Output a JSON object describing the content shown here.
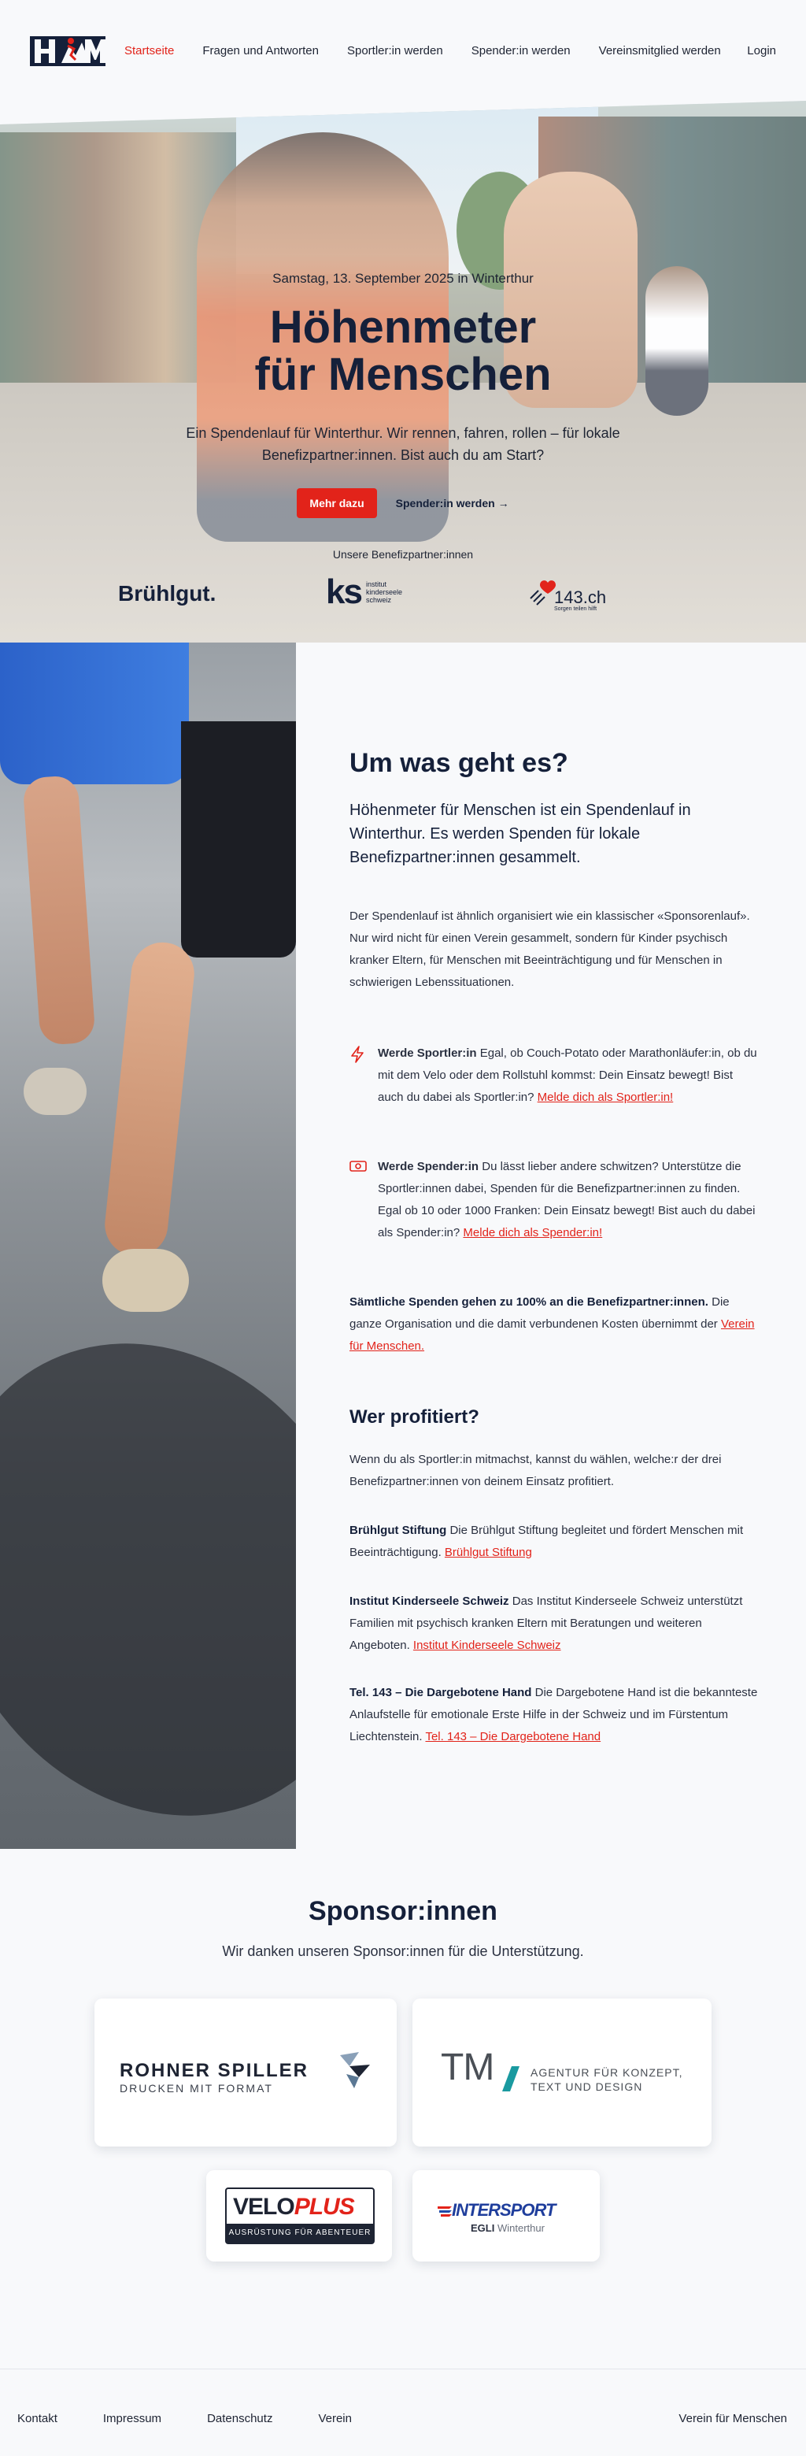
{
  "nav": {
    "items": [
      "Startseite",
      "Fragen und Antworten",
      "Sportler:in werden",
      "Spender:in werden",
      "Vereinsmitglied werden"
    ],
    "login": "Login"
  },
  "hero": {
    "date": "Samstag, 13. September 2025 in Winterthur",
    "title_line1": "Höhenmeter",
    "title_line2": "für Menschen",
    "subtitle": "Ein Spendenlauf für Winterthur. Wir rennen, fahren, rollen – für lokale Benefizpartner:innen. Bist auch du am Start?",
    "cta_primary": "Mehr dazu",
    "cta_secondary": "Spender:in werden →",
    "partners_label": "Unsere Benefizpartner:innen",
    "partners": {
      "bruhlgut": "Brühlgut.",
      "ks_mark": "ks",
      "ks_text": "institut kinderseele schweiz",
      "tel143": "143.ch",
      "tel143_tag": "Sorgen teilen hilft"
    }
  },
  "about": {
    "title": "Um was geht es?",
    "lead": "Höhenmeter für Menschen ist ein Spendenlauf in Winterthur. Es werden Spenden für lokale Benefizpartner:innen gesammelt.",
    "intro": "Der Spendenlauf ist ähnlich organisiert wie ein klassischer «Sponsorenlauf». Nur wird nicht für einen Verein gesammelt, sondern für Kinder psychisch kranker Eltern, für Menschen mit Beeinträchtigung und für Menschen in schwierigen Lebenssituationen.",
    "feature_athlete": {
      "bold": "Werde Sportler:in",
      "text": " Egal, ob Couch-Potato oder Marathonläufer:in, ob du mit dem Velo oder dem Rollstuhl kommst: Dein Einsatz bewegt! Bist auch du dabei als Sportler:in? ",
      "link": "Melde dich als Sportler:in!"
    },
    "feature_donor": {
      "bold": "Werde Spender:in",
      "text": " Du lässt lieber andere schwitzen? Unterstütze die Sportler:innen dabei, Spenden für die Benefizpartner:innen zu finden. Egal ob 10 oder 1000 Franken: Dein Einsatz bewegt! Bist auch du dabei als Spender:in? ",
      "link": "Melde dich als Spender:in!"
    },
    "note": {
      "bold": "Sämtliche Spenden gehen zu 100% an die Benefizpartner:innen.",
      "text": " Die ganze Organisation und die damit verbundenen Kosten übernimmt der ",
      "link": "Verein für Menschen."
    },
    "profit_title": "Wer profitiert?",
    "profit_intro": "Wenn du als Sportler:in mitmachst, kannst du wählen, welche:r der drei Benefizpartner:innen von deinem Einsatz profitiert.",
    "partner1": {
      "bold": "Brühlgut Stiftung",
      "text": " Die Brühlgut Stiftung begleitet und fördert Menschen mit Beeinträchtigung. ",
      "link": "Brühlgut Stiftung"
    },
    "partner2": {
      "bold": "Institut Kinderseele Schweiz",
      "text": " Das Institut Kinderseele Schweiz unterstützt Familien mit psychisch kranken Eltern mit Beratungen und weiteren Angeboten. ",
      "link": "Institut Kinderseele Schweiz"
    },
    "partner3": {
      "bold": "Tel. 143 – Die Dargebotene Hand",
      "text": " Die Dargebotene Hand ist die bekannteste Anlaufstelle für emotionale Erste Hilfe in der Schweiz und im Fürstentum Liechtenstein. ",
      "link": "Tel. 143 – Die Dargebotene Hand"
    }
  },
  "sponsors": {
    "title": "Sponsor:innen",
    "subtitle": "Wir danken unseren Sponsor:innen für die Unterstützung.",
    "rohner": {
      "name": "ROHNER SPILLER",
      "tag": "DRUCKEN MIT FORMAT"
    },
    "tm": {
      "mark": "TM",
      "tag1": "AGENTUR FÜR KONZEPT,",
      "tag2": "TEXT UND DESIGN"
    },
    "veloplus": {
      "a": "VELO",
      "b": "PLUS",
      "tag": "AUSRÜSTUNG FÜR ABENTEUER"
    },
    "intersport": {
      "name": "INTERSPORT",
      "b1": "EGLI",
      "b2": "Winterthur"
    }
  },
  "footer": {
    "links": [
      "Kontakt",
      "Impressum",
      "Datenschutz",
      "Verein"
    ],
    "right": "Verein für Menschen"
  },
  "colors": {
    "accent": "#e2231a",
    "navy": "#15203a",
    "background": "#f8f9fb"
  }
}
